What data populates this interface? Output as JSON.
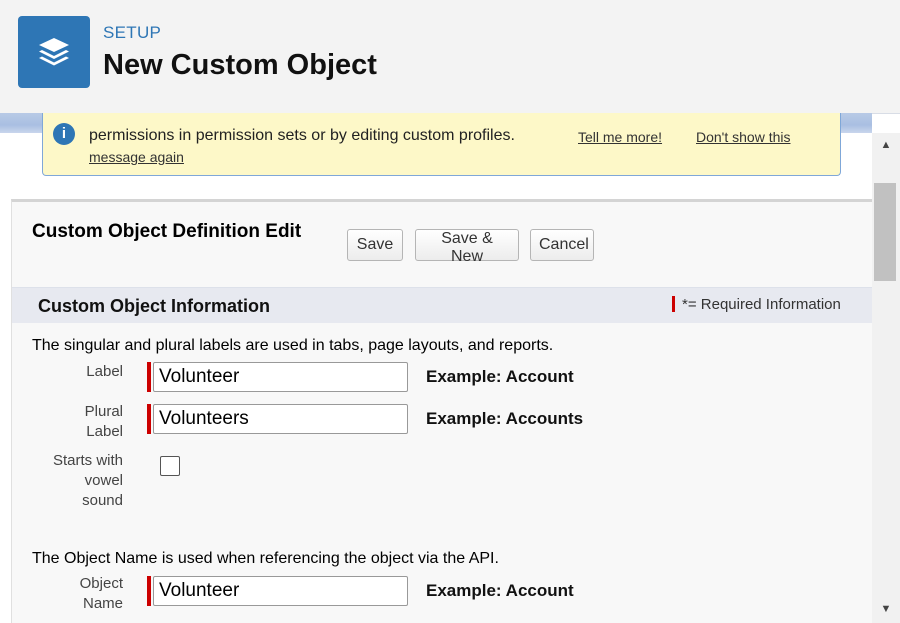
{
  "header": {
    "breadcrumb": "SETUP",
    "title": "New Custom Object",
    "icon": "layers-icon"
  },
  "banner": {
    "text": "permissions in permission sets or by editing custom profiles.",
    "tell_me_more": "Tell me more!",
    "dont_show_line1": "Don't show this",
    "dont_show_line2": "message again"
  },
  "form": {
    "title": "Custom Object Definition Edit",
    "buttons": {
      "save": "Save",
      "save_new": "Save & New",
      "cancel": "Cancel"
    },
    "section_title": "Custom Object Information",
    "required_info": "= Required Information",
    "required_info_prefix": "*",
    "labels_intro": "The singular and plural labels are used in tabs, page layouts, and reports.",
    "label": {
      "label": "Label",
      "value": "Volunteer",
      "example": "Example:  Account"
    },
    "plural_label": {
      "label_line1": "Plural",
      "label_line2": "Label",
      "value": "Volunteers",
      "example": "Example:  Accounts"
    },
    "vowel": {
      "label_line1": "Starts with",
      "label_line2": "vowel",
      "label_line3": "sound",
      "checked": false
    },
    "object_name_intro": "The Object Name is used when referencing the object via the API.",
    "object_name": {
      "label_line1": "Object",
      "label_line2": "Name",
      "value": "Volunteer",
      "example": "Example:  Account"
    }
  },
  "colors": {
    "brand": "#2e76b5",
    "required": "#cc0000",
    "banner_bg": "#fdf8c8"
  }
}
